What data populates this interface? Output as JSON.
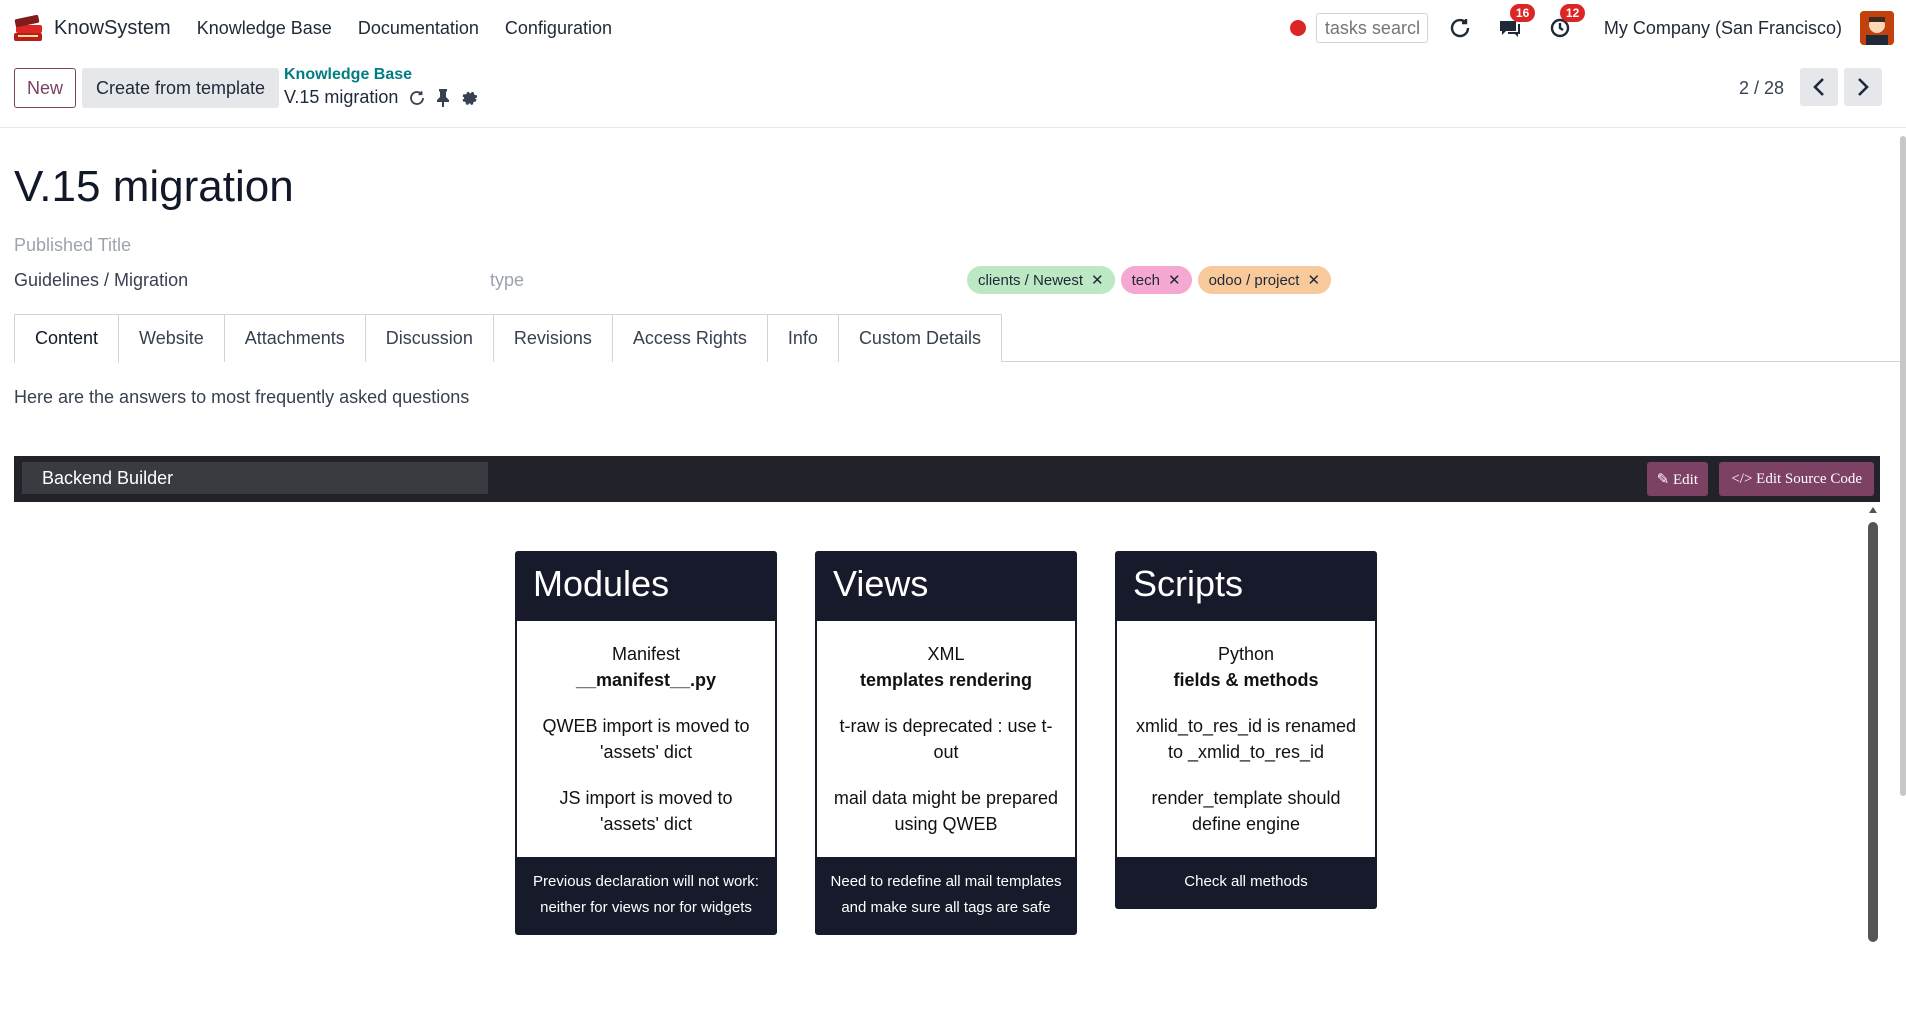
{
  "navbar": {
    "app_name": "KnowSystem",
    "menus": [
      "Knowledge Base",
      "Documentation",
      "Configuration"
    ],
    "tasks_search_placeholder": "tasks search",
    "messages_count": "16",
    "activities_count": "12",
    "company": "My Company (San Francisco)"
  },
  "control_panel": {
    "new_label": "New",
    "template_label": "Create from template",
    "breadcrumb_parent": "Knowledge Base",
    "breadcrumb_current": "V.15 migration",
    "pager": "2 / 28"
  },
  "form": {
    "title": "V.15 migration",
    "published_title_placeholder": "Published Title",
    "section": "Guidelines / Migration",
    "type_placeholder": "type",
    "tags": [
      {
        "label": "clients / Newest",
        "color": "#bde8c4"
      },
      {
        "label": "tech",
        "color": "#f5a8d1"
      },
      {
        "label": "odoo / project",
        "color": "#f8c99b"
      }
    ],
    "tabs": [
      "Content",
      "Website",
      "Attachments",
      "Discussion",
      "Revisions",
      "Access Rights",
      "Info",
      "Custom Details"
    ],
    "intro": "Here are the answers to most frequently asked questions"
  },
  "builder": {
    "label": "Backend Builder",
    "edit_label": "Edit",
    "edit_source_label": "Edit Source Code"
  },
  "cards": [
    {
      "title": "Modules",
      "subtitle": "Manifest",
      "bold": "__manifest__.py",
      "p1": "QWEB import is moved to 'assets' dict",
      "p2": "JS import is moved to 'assets' dict",
      "footer": "Previous declaration will not work: neither for views nor for widgets"
    },
    {
      "title": "Views",
      "subtitle": "XML",
      "bold": "templates rendering",
      "p1": "t-raw is deprecated : use t-out",
      "p2": "mail data might be prepared using QWEB",
      "footer": "Need to redefine all mail templates and make sure all tags are safe"
    },
    {
      "title": "Scripts",
      "subtitle": "Python",
      "bold": "fields & methods",
      "p1": "xmlid_to_res_id is renamed to _xmlid_to_res_id",
      "p2": "render_template should define engine",
      "footer": "Check all methods"
    }
  ],
  "colors": {
    "brand": "#7c4163",
    "link": "#017e84",
    "card_dark": "#171a2a"
  }
}
